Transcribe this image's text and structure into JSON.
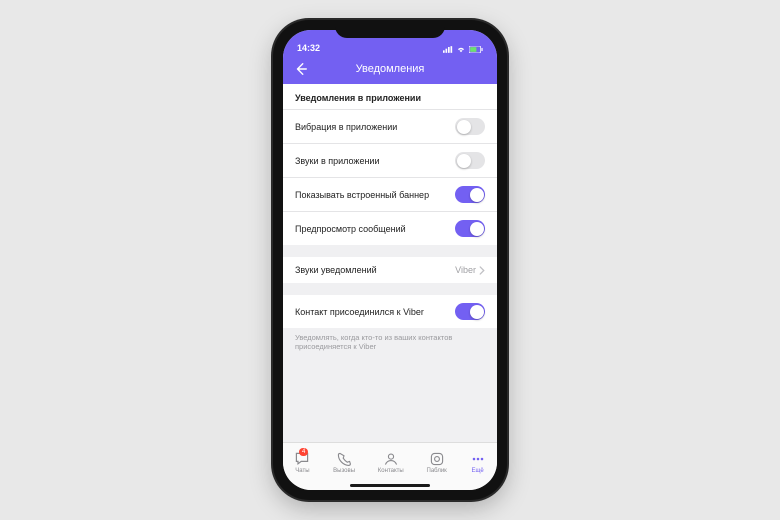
{
  "statusbar": {
    "time": "14:32"
  },
  "header": {
    "title": "Уведомления"
  },
  "section_title": "Уведомления в приложении",
  "rows": {
    "vibration": {
      "label": "Вибрация в приложении",
      "on": false
    },
    "sounds": {
      "label": "Звуки в приложении",
      "on": false
    },
    "banner": {
      "label": "Показывать встроенный баннер",
      "on": true
    },
    "preview": {
      "label": "Предпросмотр сообщений",
      "on": true
    },
    "notif_sounds": {
      "label": "Звуки уведомлений",
      "value": "Viber"
    },
    "contact_joined": {
      "label": "Контакт присоединился к Viber",
      "on": true
    }
  },
  "helper_text": "Уведомлять, когда кто-то из ваших контактов присоединяется к Viber",
  "tabs": {
    "chats": {
      "label": "Чаты",
      "badge": "4"
    },
    "calls": {
      "label": "Вызовы"
    },
    "contacts": {
      "label": "Контакты"
    },
    "public": {
      "label": "Паблик"
    },
    "more": {
      "label": "Ещё"
    }
  },
  "colors": {
    "accent": "#7360f2"
  }
}
